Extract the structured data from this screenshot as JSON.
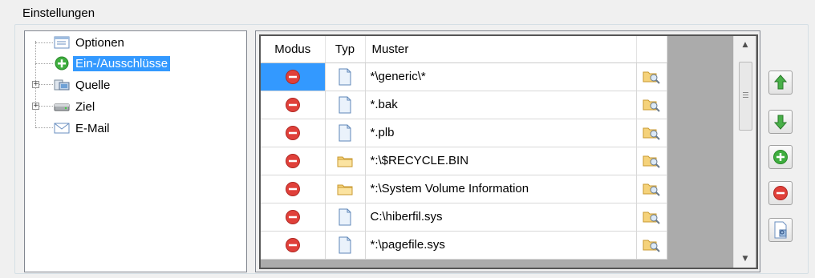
{
  "group": {
    "title": "Einstellungen"
  },
  "tree": {
    "items": [
      {
        "label": "Optionen",
        "icon": "options-icon",
        "expandable": false,
        "selected": false
      },
      {
        "label": "Ein-/Ausschlüsse",
        "icon": "include-exclude-icon",
        "expandable": false,
        "selected": true
      },
      {
        "label": "Quelle",
        "icon": "source-computer-icon",
        "expandable": true,
        "selected": false
      },
      {
        "label": "Ziel",
        "icon": "target-drive-icon",
        "expandable": true,
        "selected": false
      },
      {
        "label": "E-Mail",
        "icon": "email-icon",
        "expandable": false,
        "selected": false
      }
    ]
  },
  "grid": {
    "columns": [
      "Modus",
      "Typ",
      "Muster",
      ""
    ],
    "rows": [
      {
        "modus": "exclude",
        "typ": "file",
        "muster": "*\\generic\\*",
        "selected": true
      },
      {
        "modus": "exclude",
        "typ": "file",
        "muster": "*.bak",
        "selected": false
      },
      {
        "modus": "exclude",
        "typ": "file",
        "muster": "*.plb",
        "selected": false
      },
      {
        "modus": "exclude",
        "typ": "folder",
        "muster": "*:\\$RECYCLE.BIN",
        "selected": false
      },
      {
        "modus": "exclude",
        "typ": "folder",
        "muster": "*:\\System Volume Information",
        "selected": false
      },
      {
        "modus": "exclude",
        "typ": "file",
        "muster": "C:\\hiberfil.sys",
        "selected": false
      },
      {
        "modus": "exclude",
        "typ": "file",
        "muster": "*:\\pagefile.sys",
        "selected": false
      }
    ],
    "browse_icon": "browse-folder-icon"
  },
  "side_buttons": [
    {
      "name": "move-up-button",
      "icon": "arrow-up-icon"
    },
    {
      "name": "move-down-button",
      "icon": "arrow-down-icon"
    },
    {
      "name": "add-button",
      "icon": "add-icon"
    },
    {
      "name": "remove-button",
      "icon": "remove-icon"
    },
    {
      "name": "preview-button",
      "icon": "preview-icon"
    }
  ],
  "colors": {
    "selection": "#3399ff",
    "exclude_red": "#e0403a",
    "add_green": "#3fae3f"
  }
}
